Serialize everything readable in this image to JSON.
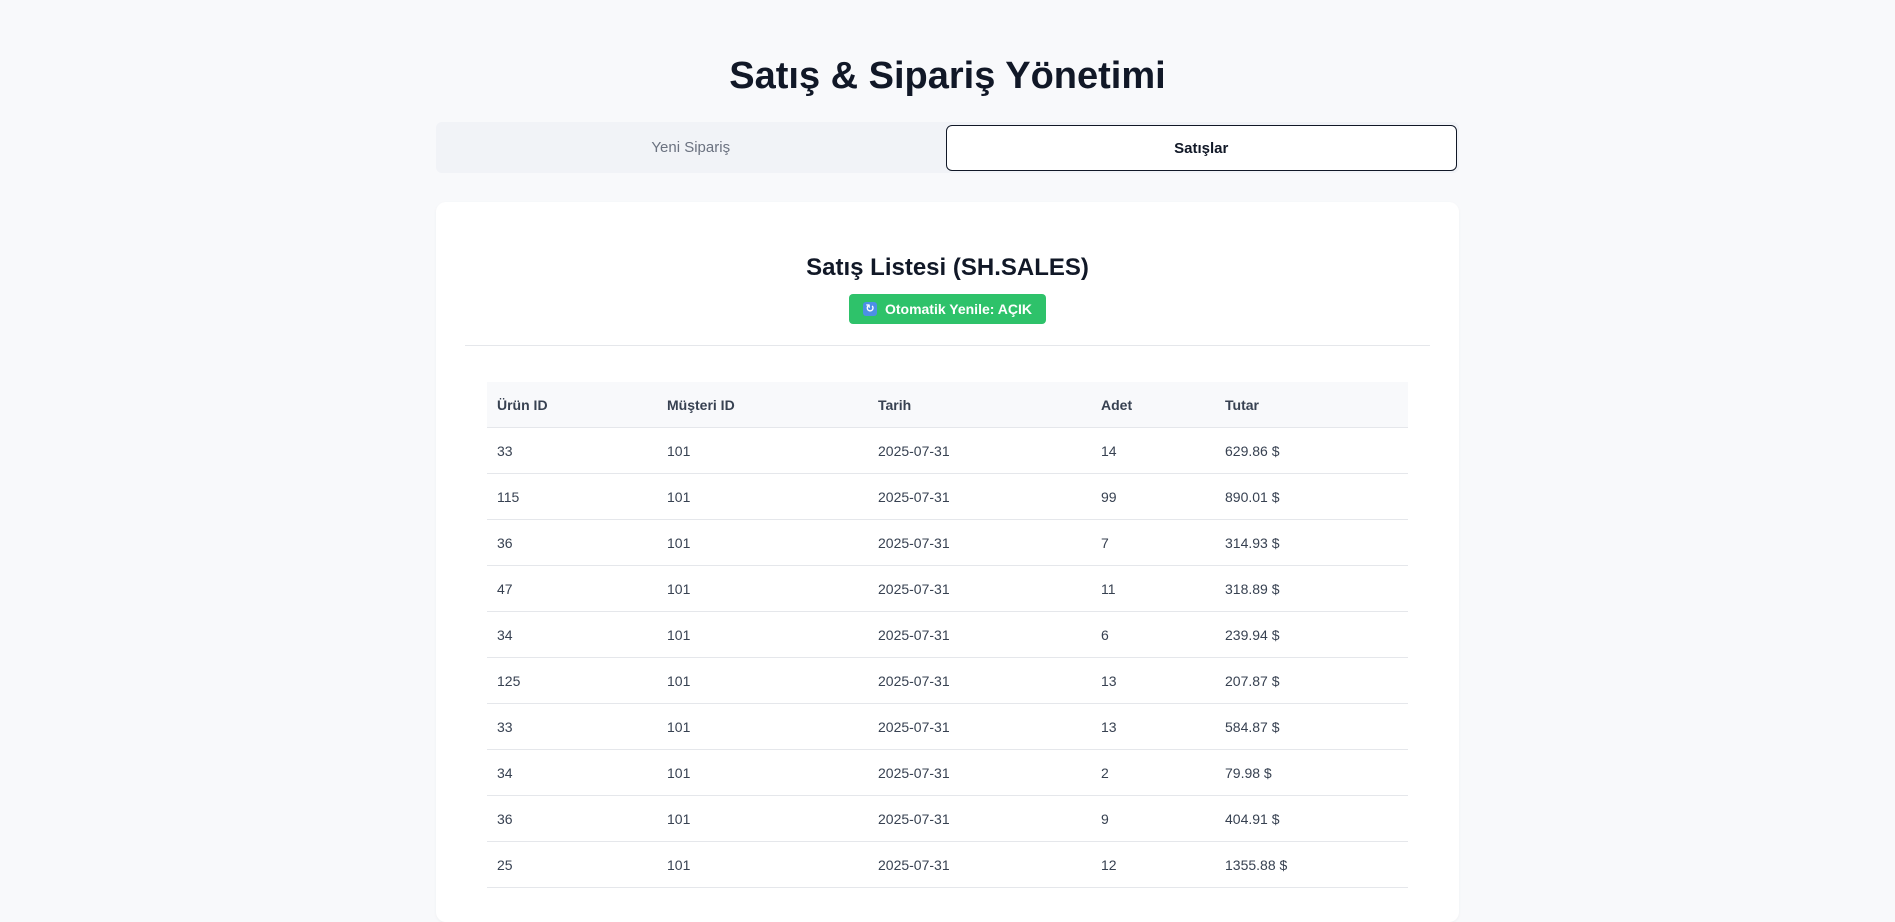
{
  "header": {
    "title": "Satış & Sipariş Yönetimi"
  },
  "tabs": [
    {
      "label": "Yeni Sipariş",
      "active": false
    },
    {
      "label": "Satışlar",
      "active": true
    }
  ],
  "sales_panel": {
    "title": "Satış Listesi (SH.SALES)",
    "auto_refresh_badge": {
      "icon": "refresh-icon",
      "label": "Otomatik Yenile: AÇIK",
      "color": "#2ec26a"
    },
    "table": {
      "columns": [
        "Ürün ID",
        "Müşteri ID",
        "Tarih",
        "Adet",
        "Tutar"
      ],
      "rows": [
        [
          "33",
          "101",
          "2025-07-31",
          "14",
          "629.86 $"
        ],
        [
          "115",
          "101",
          "2025-07-31",
          "99",
          "890.01 $"
        ],
        [
          "36",
          "101",
          "2025-07-31",
          "7",
          "314.93 $"
        ],
        [
          "47",
          "101",
          "2025-07-31",
          "11",
          "318.89 $"
        ],
        [
          "34",
          "101",
          "2025-07-31",
          "6",
          "239.94 $"
        ],
        [
          "125",
          "101",
          "2025-07-31",
          "13",
          "207.87 $"
        ],
        [
          "33",
          "101",
          "2025-07-31",
          "13",
          "584.87 $"
        ],
        [
          "34",
          "101",
          "2025-07-31",
          "2",
          "79.98 $"
        ],
        [
          "36",
          "101",
          "2025-07-31",
          "9",
          "404.91 $"
        ],
        [
          "25",
          "101",
          "2025-07-31",
          "12",
          "1355.88 $"
        ]
      ]
    }
  }
}
